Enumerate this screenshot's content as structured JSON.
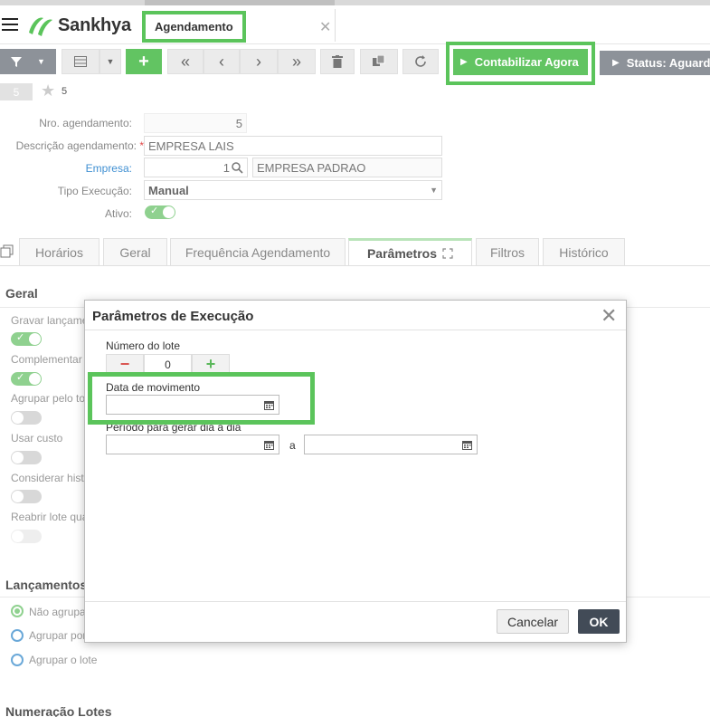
{
  "header": {
    "logo_text": "Sankhya",
    "tab_title": "Agendamento"
  },
  "toolbar": {
    "contabilizar_label": "Contabilizar Agora",
    "status_label": "Status: Aguardando"
  },
  "record": {
    "badge": "5",
    "count": "5"
  },
  "form": {
    "nro_label": "Nro. agendamento:",
    "nro_value": "5",
    "descricao_label": "Descrição agendamento:",
    "descricao_value": "EMPRESA LAIS",
    "empresa_label": "Empresa:",
    "empresa_code": "1",
    "empresa_name": "EMPRESA PADRAO",
    "tipo_label": "Tipo Execução:",
    "tipo_value": "Manual",
    "ativo_label": "Ativo:",
    "ativo_on": true
  },
  "tabs": [
    {
      "label": "Horários",
      "active": false
    },
    {
      "label": "Geral",
      "active": false
    },
    {
      "label": "Frequência Agendamento",
      "active": false
    },
    {
      "label": "Parâmetros",
      "active": true
    },
    {
      "label": "Filtros",
      "active": false
    },
    {
      "label": "Histórico",
      "active": false
    }
  ],
  "geral": {
    "title": "Geral",
    "items": [
      {
        "label": "Gravar lançame",
        "on": true
      },
      {
        "label": "Complementar",
        "on": true
      },
      {
        "label": "Agrupar pelo to",
        "on": false
      },
      {
        "label": "Usar custo",
        "on": false
      },
      {
        "label": "Considerar histi",
        "on": false
      },
      {
        "label": "Reabrir lote qua",
        "on": false
      }
    ]
  },
  "lancamentos": {
    "title": "Lançamentos",
    "options": [
      {
        "label": "Não agrupa",
        "selected": true
      },
      {
        "label": "Agrupar por",
        "selected": false
      },
      {
        "label": "Agrupar o lote",
        "selected": false
      }
    ]
  },
  "numeracao": {
    "title": "Numeração Lotes"
  },
  "modal": {
    "title": "Parâmetros de Execução",
    "lote_label": "Número do lote",
    "lote_value": "0",
    "data_mov_label": "Data de movimento",
    "data_mov_value": "",
    "periodo_label": "Período para gerar dia a dia",
    "periodo_from": "",
    "periodo_sep": "a",
    "periodo_to": "",
    "cancel_label": "Cancelar",
    "ok_label": "OK"
  },
  "colors": {
    "accent_green": "#62c462",
    "highlight_green": "#5bc45b",
    "toolbar_gray": "#8d9299",
    "ok_dark": "#424b57"
  }
}
